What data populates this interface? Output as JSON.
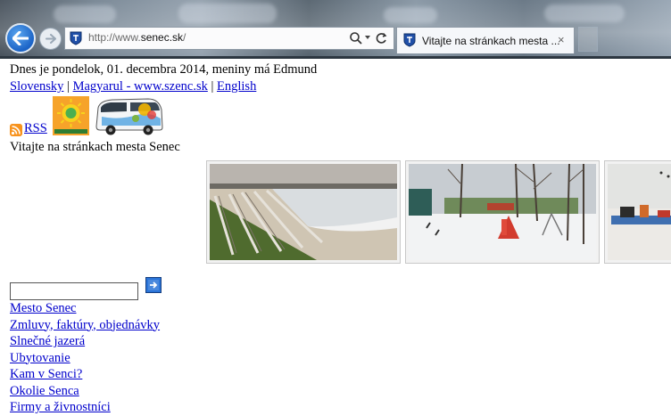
{
  "browser": {
    "url_prefix": "http://www.",
    "url_domain": "senec.sk",
    "url_suffix": "/",
    "tab_title": "Vitajte na stránkach mesta ...",
    "tab_close": "×"
  },
  "page": {
    "greeting": "Dnes je pondelok, 01. decembra 2014, meniny má Edmund",
    "languages": [
      {
        "label": "Slovensky",
        "sep": " | "
      },
      {
        "label": "Magyarul - www.szenc.sk",
        "sep": " | "
      },
      {
        "label": "English",
        "sep": ""
      }
    ],
    "rss_label": "RSS",
    "welcome": "Vitajte na stránkach mesta Senec",
    "menu": [
      "Mesto Senec",
      "Zmluvy, faktúry, objednávky",
      "Slnečné jazerá",
      "Ubytovanie",
      "Kam v Senci?",
      "Okolie Senca",
      "Firmy a živnostníci"
    ]
  },
  "colors": {
    "link": "#0000cc",
    "rss": "#f7931e",
    "back_button": "#1b63c6"
  }
}
